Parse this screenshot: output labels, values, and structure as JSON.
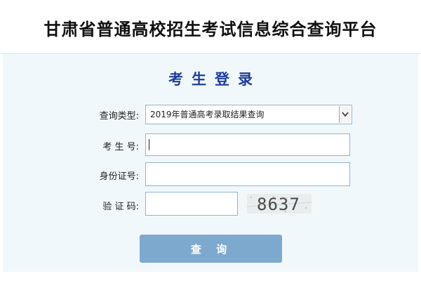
{
  "header": {
    "title": "甘肃省普通高校招生考试信息综合查询平台"
  },
  "login": {
    "heading": "考生登录",
    "query_type": {
      "label": "查询类型:",
      "selected": "2019年普通高考录取结果查询"
    },
    "exam_number": {
      "label": "考 生 号:",
      "value": ""
    },
    "id_number": {
      "label": "身份证号:",
      "value": ""
    },
    "captcha": {
      "label": "验 证 码:",
      "value": "",
      "image_text": "8637"
    },
    "submit_label": "查 询"
  },
  "colors": {
    "heading": "#1f3d99",
    "button": "#7ea9cf",
    "panel": "#f1f8fc"
  },
  "icons": {
    "dropdown": "chevron-down-icon"
  }
}
